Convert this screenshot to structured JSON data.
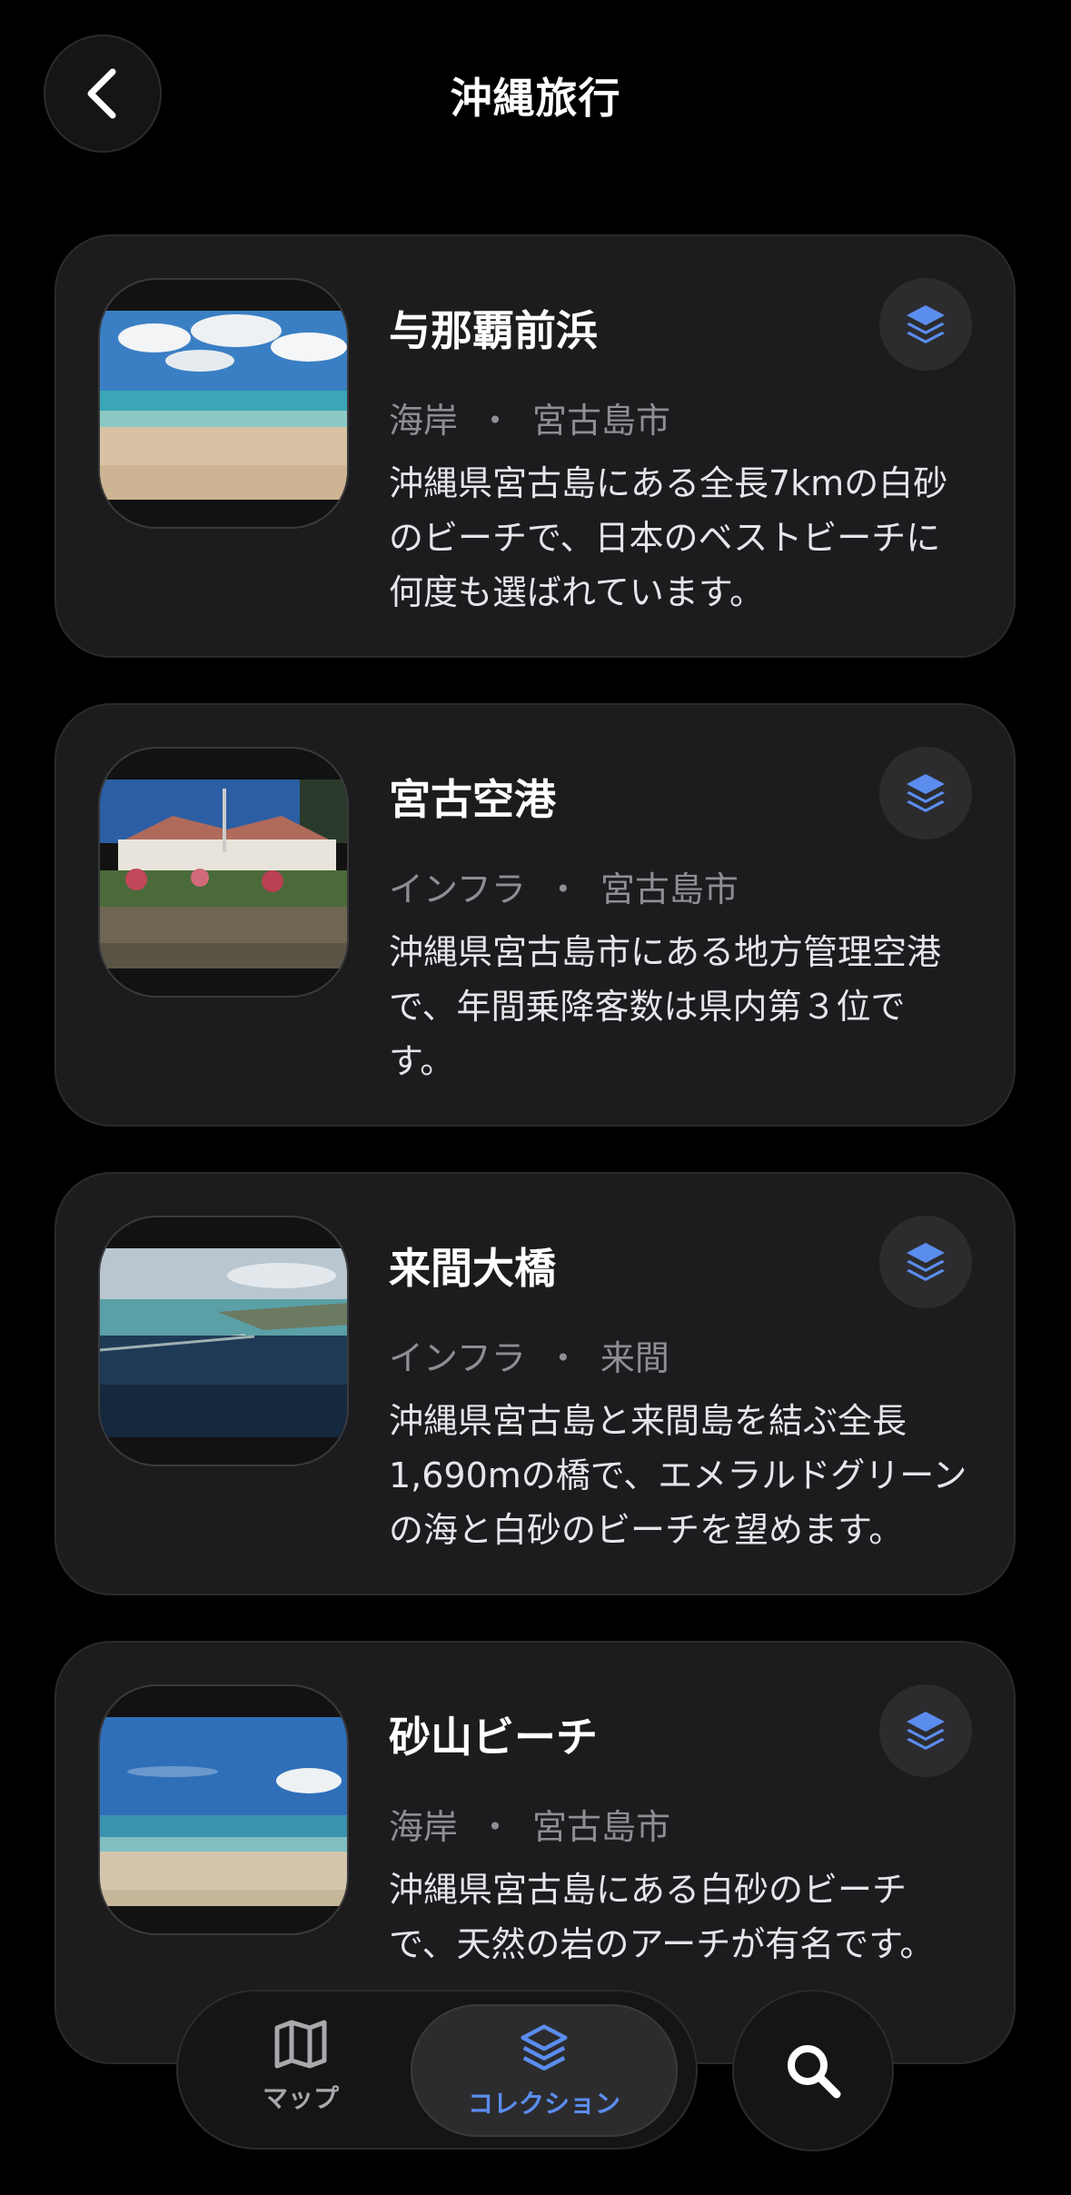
{
  "header": {
    "title": "沖縄旅行"
  },
  "places": [
    {
      "name": "与那覇前浜",
      "category": "海岸",
      "city": "宮古島市",
      "description": "沖縄県宮古島にある全長7kmの白砂のビーチで、日本のベストビーチに何度も選ばれています。"
    },
    {
      "name": "宮古空港",
      "category": "インフラ",
      "city": "宮古島市",
      "description": "沖縄県宮古島市にある地方管理空港で、年間乗降客数は県内第３位です。"
    },
    {
      "name": "来間大橋",
      "category": "インフラ",
      "city": "来間",
      "description": "沖縄県宮古島と来間島を結ぶ全長1,690mの橋で、エメラルドグリーンの海と白砂のビーチを望めます。"
    },
    {
      "name": "砂山ビーチ",
      "category": "海岸",
      "city": "宮古島市",
      "description": "沖縄県宮古島にある白砂のビーチで、天然の岩のアーチが有名です。"
    }
  ],
  "separator": "・",
  "tabbar": {
    "map_label": "マップ",
    "collection_label": "コレクション"
  },
  "colors": {
    "accent": "#5b8def",
    "card": "#1c1c1e",
    "muted": "#8e8e93"
  },
  "icons": {
    "back": "chevron-left-icon",
    "layers": "layers-icon",
    "map": "map-icon",
    "search": "search-icon"
  }
}
